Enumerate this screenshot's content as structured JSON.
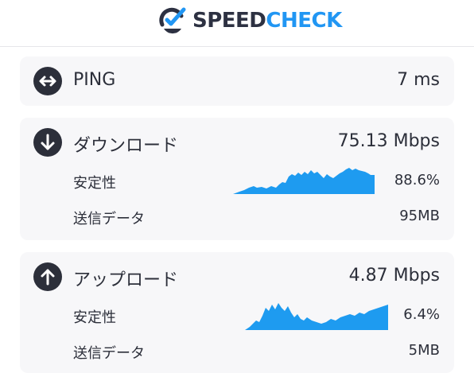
{
  "header": {
    "brand_part1": "SPEED",
    "brand_part2": "CHECK",
    "colors": {
      "dark": "#2d3142",
      "accent": "#2196f3"
    }
  },
  "ping": {
    "label": "PING",
    "value": "7 ms",
    "icon": "horizontal-arrows-icon"
  },
  "download": {
    "label": "ダウンロード",
    "value": "75.13 Mbps",
    "icon": "arrow-down-icon",
    "stability_label": "安定性",
    "stability_value": "88.6%",
    "data_label": "送信データ",
    "data_value": "95MB"
  },
  "upload": {
    "label": "アップロード",
    "value": "4.87 Mbps",
    "icon": "arrow-up-icon",
    "stability_label": "安定性",
    "stability_value": "6.4%",
    "data_label": "送信データ",
    "data_value": "5MB"
  },
  "chart_color": "#1e9bf0"
}
